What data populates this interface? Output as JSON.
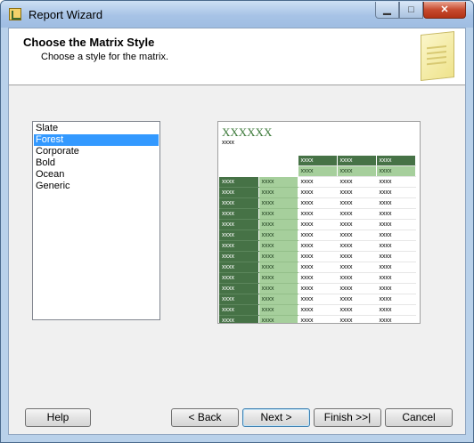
{
  "window": {
    "title": "Report Wizard"
  },
  "header": {
    "title": "Choose the Matrix Style",
    "subtitle": "Choose a style for the matrix."
  },
  "styles": {
    "items": [
      "Slate",
      "Forest",
      "Corporate",
      "Bold",
      "Ocean",
      "Generic"
    ],
    "selected": "Forest"
  },
  "preview": {
    "title": "XXXXXX",
    "subtitle": "xxxx",
    "cell": "xxxx",
    "data_rows": 14,
    "colors": {
      "dark": "#467246",
      "light": "#a6cf9c",
      "title": "#3d7a3a"
    }
  },
  "buttons": {
    "help": "Help",
    "back": "< Back",
    "next": "Next >",
    "finish": "Finish >>|",
    "cancel": "Cancel"
  },
  "titlebar": {
    "minimize_icon": "minimize-icon",
    "maximize_icon": "maximize-icon",
    "close_icon": "close-icon"
  }
}
